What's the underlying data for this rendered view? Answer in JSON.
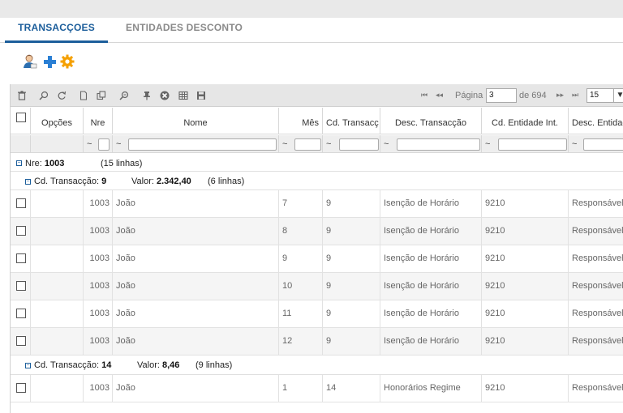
{
  "tabs": [
    {
      "label": "TRANSACÇOES",
      "active": true
    },
    {
      "label": "ENTIDADES DESCONTO",
      "active": false
    }
  ],
  "actions": [
    {
      "icon": "user-icon"
    },
    {
      "icon": "add-icon"
    },
    {
      "icon": "settings-gear-icon"
    }
  ],
  "toolbar_icons": [
    "trash-icon",
    "search-icon",
    "refresh-icon",
    "document-icon",
    "copy-icon",
    "zoom-icon",
    "pin-icon",
    "clear-filter-icon",
    "columns-icon",
    "save-icon"
  ],
  "pager": {
    "first": "⏮",
    "prev": "◂◂",
    "page_label": "Página",
    "page_value": "3",
    "of_label": "de 694",
    "next": "▸▸",
    "last": "⏭",
    "page_size": "15",
    "dropdown_arrow": "▼"
  },
  "columns": [
    "",
    "Opções",
    "Nre",
    "Nome",
    "Mês",
    "Cd. Transacç",
    "Desc. Transacção",
    "Cd. Entidade Int.",
    "Desc. Entidad"
  ],
  "filter": {
    "tilde": "~"
  },
  "groups": {
    "nre": {
      "label": "Nre:",
      "value": "1003",
      "count": "(15 linhas)"
    },
    "g1": {
      "label": "Cd. Transacção:",
      "value": "9",
      "valor_label": "Valor:",
      "valor": "2.342,40",
      "count": "(6 linhas)"
    },
    "g2": {
      "label": "Cd. Transacção:",
      "value": "14",
      "valor_label": "Valor:",
      "valor": "8,46",
      "count": "(9 linhas)"
    }
  },
  "rows": [
    {
      "nre": "1003",
      "nome": "João",
      "mes": "7",
      "cd": "9",
      "desc": "Isenção de Horário",
      "ent": "9210",
      "desc_ent": "Responsável"
    },
    {
      "nre": "1003",
      "nome": "João",
      "mes": "8",
      "cd": "9",
      "desc": "Isenção de Horário",
      "ent": "9210",
      "desc_ent": "Responsável"
    },
    {
      "nre": "1003",
      "nome": "João",
      "mes": "9",
      "cd": "9",
      "desc": "Isenção de Horário",
      "ent": "9210",
      "desc_ent": "Responsável"
    },
    {
      "nre": "1003",
      "nome": "João",
      "mes": "10",
      "cd": "9",
      "desc": "Isenção de Horário",
      "ent": "9210",
      "desc_ent": "Responsável"
    },
    {
      "nre": "1003",
      "nome": "João",
      "mes": "11",
      "cd": "9",
      "desc": "Isenção de Horário",
      "ent": "9210",
      "desc_ent": "Responsável"
    },
    {
      "nre": "1003",
      "nome": "João",
      "mes": "12",
      "cd": "9",
      "desc": "Isenção de Horário",
      "ent": "9210",
      "desc_ent": "Responsável"
    },
    {
      "nre": "1003",
      "nome": "João",
      "mes": "1",
      "cd": "14",
      "desc": "Honorários Regime",
      "ent": "9210",
      "desc_ent": "Responsável"
    }
  ],
  "colors": {
    "accent": "#1c5e9b",
    "gear": "#f5a000",
    "plus": "#2a7fd4"
  }
}
